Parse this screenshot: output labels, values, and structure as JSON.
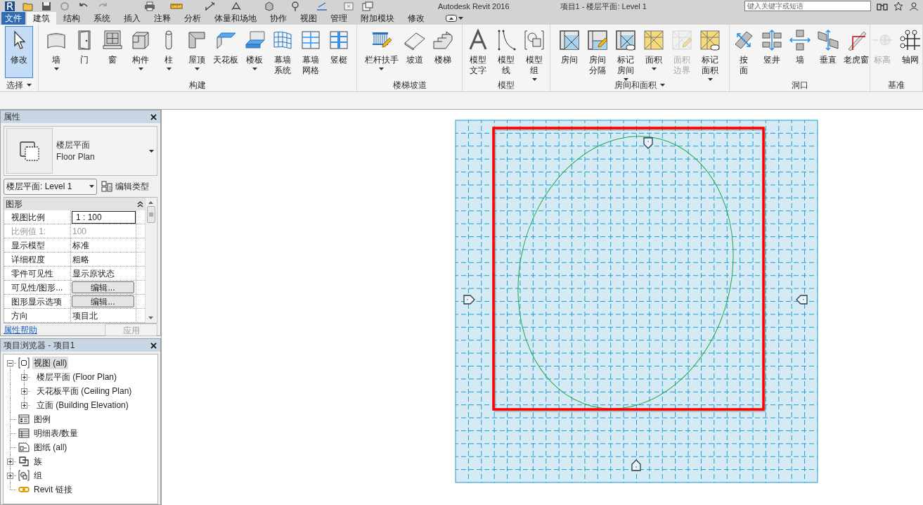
{
  "title_bar": {
    "app_name": "Autodesk Revit 2016",
    "document": "项目1 - 楼层平面: Level 1",
    "search": {
      "placeholder": "键入关键字或短语"
    }
  },
  "ribbon": {
    "tabs": [
      {
        "label": "文件",
        "kind": "application",
        "selected": false
      },
      {
        "label": "建筑",
        "kind": "tab",
        "selected": true
      },
      {
        "label": "结构",
        "kind": "tab",
        "selected": false
      },
      {
        "label": "系统",
        "kind": "tab",
        "selected": false
      },
      {
        "label": "插入",
        "kind": "tab",
        "selected": false
      },
      {
        "label": "注释",
        "kind": "tab",
        "selected": false
      },
      {
        "label": "分析",
        "kind": "tab",
        "selected": false
      },
      {
        "label": "体量和场地",
        "kind": "tab",
        "selected": false
      },
      {
        "label": "协作",
        "kind": "tab",
        "selected": false
      },
      {
        "label": "视图",
        "kind": "tab",
        "selected": false
      },
      {
        "label": "管理",
        "kind": "tab",
        "selected": false
      },
      {
        "label": "附加模块",
        "kind": "tab",
        "selected": false
      },
      {
        "label": "修改",
        "kind": "tab",
        "selected": false
      }
    ],
    "panels": [
      {
        "label": "选择",
        "dropdown": true,
        "buttons": [
          {
            "label": "修改",
            "kind": "select",
            "dropdown": false,
            "disabled": false,
            "selected": true
          }
        ]
      },
      {
        "label": "构建",
        "dropdown": false,
        "buttons": [
          {
            "label": "墙",
            "kind": "wall",
            "dropdown": true,
            "disabled": false,
            "selected": false
          },
          {
            "label": "门",
            "kind": "door",
            "dropdown": false,
            "disabled": false,
            "selected": false
          },
          {
            "label": "窗",
            "kind": "window",
            "dropdown": false,
            "disabled": false,
            "selected": false
          },
          {
            "label": "构件",
            "kind": "component",
            "dropdown": true,
            "disabled": false,
            "selected": false
          },
          {
            "label": "柱",
            "kind": "column",
            "dropdown": true,
            "disabled": false,
            "selected": false
          },
          {
            "label": "屋顶",
            "kind": "roof",
            "dropdown": true,
            "disabled": false,
            "selected": false
          },
          {
            "label": "天花板",
            "kind": "ceiling",
            "dropdown": false,
            "disabled": false,
            "selected": false
          },
          {
            "label": "楼板",
            "kind": "floor",
            "dropdown": true,
            "disabled": false,
            "selected": false
          },
          {
            "label": "幕墙系统",
            "kind": "curtainsystem",
            "dropdown": false,
            "disabled": false,
            "selected": false
          },
          {
            "label": "幕墙网格",
            "kind": "curtaingrid",
            "dropdown": false,
            "disabled": false,
            "selected": false
          },
          {
            "label": "竖梃",
            "kind": "mullion",
            "dropdown": false,
            "disabled": false,
            "selected": false
          }
        ]
      },
      {
        "label": "楼梯坡道",
        "dropdown": false,
        "buttons": [
          {
            "label": "栏杆扶手",
            "kind": "railing",
            "dropdown": true,
            "disabled": false,
            "selected": false
          },
          {
            "label": "坡道",
            "kind": "ramp",
            "dropdown": false,
            "disabled": false,
            "selected": false
          },
          {
            "label": "楼梯",
            "kind": "stair",
            "dropdown": false,
            "disabled": false,
            "selected": false
          }
        ]
      },
      {
        "label": "模型",
        "dropdown": false,
        "buttons": [
          {
            "label": "模型文字",
            "kind": "modeltext",
            "dropdown": false,
            "disabled": false,
            "selected": false
          },
          {
            "label": "模型线",
            "kind": "modelline",
            "dropdown": false,
            "disabled": false,
            "selected": false
          },
          {
            "label": "模型组",
            "kind": "modelgroup",
            "dropdown": true,
            "disabled": false,
            "selected": false
          }
        ]
      },
      {
        "label": "房间和面积",
        "dropdown": true,
        "buttons": [
          {
            "label": "房间",
            "kind": "room",
            "dropdown": false,
            "disabled": false,
            "selected": false
          },
          {
            "label": "房间分隔",
            "kind": "roomseparator",
            "dropdown": false,
            "disabled": false,
            "selected": false
          },
          {
            "label": "标记房间",
            "kind": "tagroom",
            "dropdown": true,
            "disabled": false,
            "selected": false
          },
          {
            "label": "面积",
            "kind": "area",
            "dropdown": true,
            "disabled": false,
            "selected": false
          },
          {
            "label": "面积边界",
            "kind": "areaboundary",
            "dropdown": false,
            "disabled": true,
            "selected": false
          },
          {
            "label": "标记面积",
            "kind": "tagarea",
            "dropdown": true,
            "disabled": false,
            "selected": false
          }
        ]
      },
      {
        "label": "洞口",
        "dropdown": false,
        "buttons": [
          {
            "label": "按面",
            "kind": "byface",
            "dropdown": false,
            "disabled": false,
            "selected": false
          },
          {
            "label": "竖井",
            "kind": "shaft",
            "dropdown": false,
            "disabled": false,
            "selected": false
          },
          {
            "label": "墙",
            "kind": "wallopening",
            "dropdown": false,
            "disabled": false,
            "selected": false
          },
          {
            "label": "垂直",
            "kind": "vertical",
            "dropdown": false,
            "disabled": false,
            "selected": false
          },
          {
            "label": "老虎窗",
            "kind": "dormer",
            "dropdown": false,
            "disabled": false,
            "selected": false
          }
        ]
      },
      {
        "label": "基准",
        "dropdown": false,
        "buttons": [
          {
            "label": "标高",
            "kind": "level",
            "dropdown": false,
            "disabled": true,
            "selected": false
          },
          {
            "label": "轴网",
            "kind": "grid",
            "dropdown": false,
            "disabled": false,
            "selected": false
          }
        ]
      }
    ]
  },
  "properties": {
    "title": "属性",
    "type_selector": {
      "name": "楼层平面",
      "name_en": "Floor Plan"
    },
    "instance_selector": "楼层平面: Level 1",
    "edit_type": "编辑类型",
    "group": {
      "label": "图形",
      "expanded": true
    },
    "rows": [
      {
        "name": "视图比例",
        "value": "1 : 100",
        "kind": "input",
        "disabled": false
      },
      {
        "name": "比例值 1:",
        "value": "100",
        "kind": "text",
        "disabled": true
      },
      {
        "name": "显示模型",
        "value": "标准",
        "kind": "text",
        "disabled": false
      },
      {
        "name": "详细程度",
        "value": "粗略",
        "kind": "text",
        "disabled": false
      },
      {
        "name": "零件可见性",
        "value": "显示原状态",
        "kind": "text",
        "disabled": false
      },
      {
        "name": "可见性/图形...",
        "value": "编辑...",
        "kind": "button",
        "disabled": false
      },
      {
        "name": "图形显示选项",
        "value": "编辑...",
        "kind": "button",
        "disabled": false
      },
      {
        "name": "方向",
        "value": "项目北",
        "kind": "text",
        "disabled": false
      }
    ],
    "help_link": "属性帮助",
    "apply": {
      "label": "应用",
      "disabled": true
    }
  },
  "project_browser": {
    "title": "项目浏览器 - 项目1",
    "tree": [
      {
        "label": "视图 (all)",
        "kind": "views",
        "expandable": true,
        "expanded": true,
        "selected": true,
        "children": [
          {
            "label": "楼层平面 (Floor Plan)",
            "expandable": true,
            "expanded": false,
            "selected": false
          },
          {
            "label": "天花板平面 (Ceiling Plan)",
            "expandable": true,
            "expanded": false,
            "selected": false
          },
          {
            "label": "立面 (Building Elevation)",
            "expandable": true,
            "expanded": false,
            "selected": false
          }
        ]
      },
      {
        "label": "图例",
        "kind": "legends",
        "expandable": false,
        "selected": false
      },
      {
        "label": "明细表/数量",
        "kind": "schedules",
        "expandable": false,
        "selected": false
      },
      {
        "label": "图纸 (all)",
        "kind": "sheets",
        "expandable": false,
        "selected": false
      },
      {
        "label": "族",
        "kind": "families",
        "expandable": true,
        "expanded": false,
        "selected": false
      },
      {
        "label": "组",
        "kind": "groups",
        "expandable": true,
        "expanded": false,
        "selected": false
      },
      {
        "label": "Revit 链接",
        "kind": "links",
        "expandable": false,
        "selected": false
      }
    ]
  }
}
